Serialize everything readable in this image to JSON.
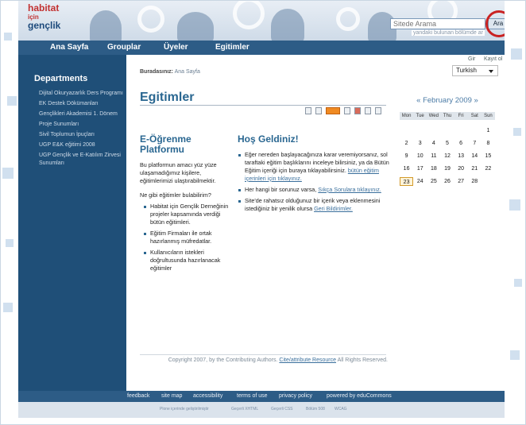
{
  "search": {
    "placeholder": "Sitede Arama",
    "button": "Ara",
    "hint": "yandaki bulunan bölümde ar"
  },
  "logo": {
    "line1": "habitat",
    "line2": "için",
    "line3": "gençlik"
  },
  "nav": {
    "items": [
      "Ana Sayfa",
      "Grouplar",
      "Üyeler",
      "Egitimler"
    ]
  },
  "sidebar": {
    "title": "Departments",
    "items": [
      "Dijital Okuryazarlık Ders Programı",
      "EK Destek Dökümanları",
      "Gençlikleri Akademisi 1. Dönem",
      "Proje Sunumları",
      "Sivil Toplumun İpuçları",
      "UGP E&K eğitimi 2008",
      "UGP Gençlik ve E-Katılım Zirvesi Sunumları"
    ]
  },
  "breadcrumb": {
    "label": "Buradasınız:",
    "current": "Ana Sayfa"
  },
  "account": {
    "login": "Gir",
    "register": "Kayıt ol",
    "language": "Turkish"
  },
  "page": {
    "title": "Egitimler"
  },
  "left": {
    "heading": "E-Öğrenme Platformu",
    "intro": "Bu platformun amacı yüz yüze ulaşamadığımız kişilere, eğitimlerimizi ulaştırabilmektir.",
    "question": "Ne gibi eğitimler bulabilirim?",
    "items": [
      "Habitat için Gençlik Derneğinin projeler kapsamında verdiği bütün eğitimleri.",
      "Eğitim Firmaları ile ortak hazırlanmış müfredatlar.",
      "Kullanıcıların istekleri doğrultusunda hazırlanacak eğitimler"
    ]
  },
  "right": {
    "heading": "Hoş Geldiniz!",
    "item1_text": "Eğer nereden başlayacağınıza karar veremiyorsanız, sol taraftaki eğitim başlıklarını inceleye bilirsiniz, ya da Bütün Eğitim içeriği için buraya tıklayabilirsiniz.",
    "item1_link": "bütün eğitim içerinleri için tıklayınız.",
    "item2_text": "Her hangi bir sorunuz varsa,",
    "item2_link": "Sıkça Sorulara tıklayınız.",
    "item3_text": "Site'de rahatsız olduğunuz bir içerik veya eklenmesini istediğiniz bir yenilik olursa",
    "item3_link": "Geri Bildirimler."
  },
  "copyright": {
    "text": "Copyright 2007, by the Contributing Authors.",
    "link": "Cite/attribute Resource",
    "suffix": "All Rights Reserved."
  },
  "calendar": {
    "prev": "«",
    "month": "February 2009",
    "next": "»",
    "days": [
      "Mon",
      "Tue",
      "Wed",
      "Thu",
      "Fri",
      "Sat",
      "Sun"
    ],
    "grid": [
      "",
      "",
      "",
      "",
      "",
      "",
      "1",
      "2",
      "3",
      "4",
      "5",
      "6",
      "7",
      "8",
      "9",
      "10",
      "11",
      "12",
      "13",
      "14",
      "15",
      "16",
      "17",
      "18",
      "19",
      "20",
      "21",
      "22",
      "23",
      "24",
      "25",
      "26",
      "27",
      "28",
      ""
    ],
    "today": "23"
  },
  "footer": {
    "links": [
      "feedback",
      "site map",
      "accessibility",
      "terms of use",
      "privacy policy",
      "powered by eduCommons"
    ]
  },
  "subfooter": {
    "items": [
      "Plone içerinde geliştirilmiştir",
      "Geçerli XHTML",
      "Geçerli CSS",
      "Bölüm 508",
      "WCAG"
    ]
  }
}
